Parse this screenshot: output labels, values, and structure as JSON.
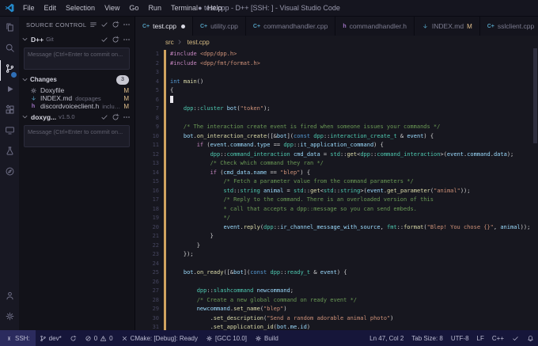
{
  "colors": {
    "accent_blue": "#2f6fb7",
    "git_modified": "#e2c08d",
    "modified_gutter": "#cfa35f",
    "status_bar_bg": "#16163a",
    "remote_item_bg": "#2b2b5e"
  },
  "title_bar": {
    "menus": [
      "File",
      "Edit",
      "Selection",
      "View",
      "Go",
      "Run",
      "Terminal",
      "Help"
    ],
    "title": "● test.cpp - D++ [SSH: ] - Visual Studio Code"
  },
  "activity_bar": {
    "top": [
      {
        "name": "explorer",
        "icon": "files"
      },
      {
        "name": "search",
        "icon": "search"
      },
      {
        "name": "source-control",
        "icon": "branch",
        "active": true,
        "badge": true
      },
      {
        "name": "run-and-debug",
        "icon": "debug"
      },
      {
        "name": "extensions",
        "icon": "extensions"
      },
      {
        "name": "remote-explorer",
        "icon": "monitor"
      },
      {
        "name": "testing",
        "icon": "beaker"
      },
      {
        "name": "gitlens",
        "icon": "compass"
      }
    ],
    "bottom": [
      {
        "name": "accounts",
        "icon": "person"
      },
      {
        "name": "manage-settings",
        "icon": "gear"
      }
    ]
  },
  "sidebar": {
    "title": "SOURCE CONTROL",
    "header_icons": [
      "list",
      "check",
      "refresh",
      "more"
    ],
    "repo1": {
      "name": "D++",
      "type": "Git",
      "icons": [
        "check",
        "refresh",
        "more"
      ]
    },
    "commit_placeholder": "Message (Ctrl+Enter to commit on...",
    "changes_label": "Changes",
    "changes_badge": "3",
    "files": [
      {
        "name": "Doxyfile",
        "desc": "",
        "status": "M",
        "icon": "gen"
      },
      {
        "name": "INDEX.md",
        "desc": "docpages",
        "status": "M",
        "icon": "md"
      },
      {
        "name": "discordvoiceclient.h",
        "desc": "include/d...",
        "status": "M",
        "icon": "h"
      }
    ],
    "repo2": {
      "name": "doxyg...",
      "version": "v1.5.0",
      "icons": [
        "check",
        "refresh",
        "more"
      ]
    },
    "commit_placeholder2": "Message (Ctrl+Enter to commit on..."
  },
  "tabs": [
    {
      "label": "test.cpp",
      "icon": "cpp",
      "active": true,
      "modified": true
    },
    {
      "label": "utility.cpp",
      "icon": "cpp"
    },
    {
      "label": "commandhandler.cpp",
      "icon": "cpp"
    },
    {
      "label": "commandhandler.h",
      "icon": "h"
    },
    {
      "label": "INDEX.md",
      "icon": "md",
      "badge": "M"
    },
    {
      "label": "sslclient.cpp",
      "icon": "cpp"
    }
  ],
  "breadcrumb": {
    "folder": "src",
    "file": "test.cpp",
    "file_icon": "cpp"
  },
  "editor": {
    "lines": [
      {
        "n": 1,
        "t": [
          [
            "pp",
            "#include"
          ],
          [
            "pl",
            " "
          ],
          [
            "st",
            "<dpp/dpp.h>"
          ]
        ]
      },
      {
        "n": 2,
        "t": [
          [
            "pp",
            "#include"
          ],
          [
            "pl",
            " "
          ],
          [
            "st",
            "<dpp/fmt/format.h>"
          ]
        ]
      },
      {
        "n": 3,
        "t": []
      },
      {
        "n": 4,
        "t": [
          [
            "kw",
            "int"
          ],
          [
            "pl",
            " "
          ],
          [
            "fn",
            "main"
          ],
          [
            "pl",
            "()"
          ]
        ]
      },
      {
        "n": 5,
        "t": [
          [
            "pl",
            "{"
          ]
        ]
      },
      {
        "n": 6,
        "cursor": true,
        "t": []
      },
      {
        "n": 7,
        "t": [
          [
            "pl",
            "    "
          ],
          [
            "ty",
            "dpp"
          ],
          [
            "pl",
            "::"
          ],
          [
            "ty",
            "cluster"
          ],
          [
            "pl",
            " "
          ],
          [
            "va",
            "bot"
          ],
          [
            "pl",
            "("
          ],
          [
            "st",
            "\"token\""
          ],
          [
            "pl",
            ");"
          ]
        ]
      },
      {
        "n": 8,
        "t": []
      },
      {
        "n": 9,
        "t": [
          [
            "pl",
            "    "
          ],
          [
            "cm",
            "/* The interaction create event is fired when someone issues your commands */"
          ]
        ]
      },
      {
        "n": 10,
        "t": [
          [
            "pl",
            "    "
          ],
          [
            "va",
            "bot"
          ],
          [
            "pl",
            "."
          ],
          [
            "fn",
            "on_interaction_create"
          ],
          [
            "pl",
            "([&"
          ],
          [
            "va",
            "bot"
          ],
          [
            "pl",
            "]("
          ],
          [
            "kw",
            "const"
          ],
          [
            "pl",
            " "
          ],
          [
            "ty",
            "dpp"
          ],
          [
            "pl",
            "::"
          ],
          [
            "ty",
            "interaction_create_t"
          ],
          [
            "pl",
            " & "
          ],
          [
            "va",
            "event"
          ],
          [
            "pl",
            ") {"
          ]
        ]
      },
      {
        "n": 11,
        "t": [
          [
            "pl",
            "        "
          ],
          [
            "ctl",
            "if"
          ],
          [
            "pl",
            " ("
          ],
          [
            "va",
            "event"
          ],
          [
            "pl",
            "."
          ],
          [
            "va",
            "command"
          ],
          [
            "pl",
            "."
          ],
          [
            "va",
            "type"
          ],
          [
            "pl",
            " == "
          ],
          [
            "ty",
            "dpp"
          ],
          [
            "pl",
            "::"
          ],
          [
            "va",
            "it_application_command"
          ],
          [
            "pl",
            ") {"
          ]
        ]
      },
      {
        "n": 12,
        "t": [
          [
            "pl",
            "            "
          ],
          [
            "ty",
            "dpp"
          ],
          [
            "pl",
            "::"
          ],
          [
            "ty",
            "command_interaction"
          ],
          [
            "pl",
            " "
          ],
          [
            "va",
            "cmd_data"
          ],
          [
            "pl",
            " = "
          ],
          [
            "ty",
            "std"
          ],
          [
            "pl",
            "::"
          ],
          [
            "fn",
            "get"
          ],
          [
            "pl",
            "<"
          ],
          [
            "ty",
            "dpp"
          ],
          [
            "pl",
            "::"
          ],
          [
            "ty",
            "command_interaction"
          ],
          [
            "pl",
            ">("
          ],
          [
            "va",
            "event"
          ],
          [
            "pl",
            "."
          ],
          [
            "va",
            "command"
          ],
          [
            "pl",
            "."
          ],
          [
            "va",
            "data"
          ],
          [
            "pl",
            ");"
          ]
        ]
      },
      {
        "n": 13,
        "t": [
          [
            "pl",
            "            "
          ],
          [
            "cm",
            "/* Check which command they ran */"
          ]
        ]
      },
      {
        "n": 14,
        "t": [
          [
            "pl",
            "            "
          ],
          [
            "ctl",
            "if"
          ],
          [
            "pl",
            " ("
          ],
          [
            "va",
            "cmd_data"
          ],
          [
            "pl",
            "."
          ],
          [
            "va",
            "name"
          ],
          [
            "pl",
            " == "
          ],
          [
            "st",
            "\"blep\""
          ],
          [
            "pl",
            ") {"
          ]
        ]
      },
      {
        "n": 15,
        "t": [
          [
            "pl",
            "                "
          ],
          [
            "cm",
            "/* Fetch a parameter value from the command parameters */"
          ]
        ]
      },
      {
        "n": 16,
        "t": [
          [
            "pl",
            "                "
          ],
          [
            "ty",
            "std"
          ],
          [
            "pl",
            "::"
          ],
          [
            "ty",
            "string"
          ],
          [
            "pl",
            " "
          ],
          [
            "va",
            "animal"
          ],
          [
            "pl",
            " = "
          ],
          [
            "ty",
            "std"
          ],
          [
            "pl",
            "::"
          ],
          [
            "fn",
            "get"
          ],
          [
            "pl",
            "<"
          ],
          [
            "ty",
            "std"
          ],
          [
            "pl",
            "::"
          ],
          [
            "ty",
            "string"
          ],
          [
            "pl",
            ">("
          ],
          [
            "va",
            "event"
          ],
          [
            "pl",
            "."
          ],
          [
            "fn",
            "get_parameter"
          ],
          [
            "pl",
            "("
          ],
          [
            "st",
            "\"animal\""
          ],
          [
            "pl",
            "));"
          ]
        ]
      },
      {
        "n": 17,
        "t": [
          [
            "pl",
            "                "
          ],
          [
            "cm",
            "/* Reply to the command. There is an overloaded version of this"
          ]
        ]
      },
      {
        "n": 18,
        "t": [
          [
            "pl",
            "                "
          ],
          [
            "cm",
            "* call that accepts a dpp::message so you can send embeds."
          ]
        ]
      },
      {
        "n": 19,
        "t": [
          [
            "pl",
            "                "
          ],
          [
            "cm",
            "*/"
          ]
        ]
      },
      {
        "n": 20,
        "t": [
          [
            "pl",
            "                "
          ],
          [
            "va",
            "event"
          ],
          [
            "pl",
            "."
          ],
          [
            "fn",
            "reply"
          ],
          [
            "pl",
            "("
          ],
          [
            "ty",
            "dpp"
          ],
          [
            "pl",
            "::"
          ],
          [
            "va",
            "ir_channel_message_with_source"
          ],
          [
            "pl",
            ", "
          ],
          [
            "ty",
            "fmt"
          ],
          [
            "pl",
            "::"
          ],
          [
            "fn",
            "format"
          ],
          [
            "pl",
            "("
          ],
          [
            "st",
            "\"Blep! You chose {}\""
          ],
          [
            "pl",
            ", "
          ],
          [
            "va",
            "animal"
          ],
          [
            "pl",
            "));"
          ]
        ]
      },
      {
        "n": 21,
        "t": [
          [
            "pl",
            "            }"
          ]
        ]
      },
      {
        "n": 22,
        "t": [
          [
            "pl",
            "        }"
          ]
        ]
      },
      {
        "n": 23,
        "t": [
          [
            "pl",
            "    });"
          ]
        ]
      },
      {
        "n": 24,
        "t": []
      },
      {
        "n": 25,
        "t": [
          [
            "pl",
            "    "
          ],
          [
            "va",
            "bot"
          ],
          [
            "pl",
            "."
          ],
          [
            "fn",
            "on_ready"
          ],
          [
            "pl",
            "([&"
          ],
          [
            "va",
            "bot"
          ],
          [
            "pl",
            "]("
          ],
          [
            "kw",
            "const"
          ],
          [
            "pl",
            " "
          ],
          [
            "ty",
            "dpp"
          ],
          [
            "pl",
            "::"
          ],
          [
            "ty",
            "ready_t"
          ],
          [
            "pl",
            " & "
          ],
          [
            "va",
            "event"
          ],
          [
            "pl",
            ") {"
          ]
        ]
      },
      {
        "n": 26,
        "t": []
      },
      {
        "n": 27,
        "t": [
          [
            "pl",
            "        "
          ],
          [
            "ty",
            "dpp"
          ],
          [
            "pl",
            "::"
          ],
          [
            "ty",
            "slashcommand"
          ],
          [
            "pl",
            " "
          ],
          [
            "va",
            "newcommand"
          ],
          [
            "pl",
            ";"
          ]
        ]
      },
      {
        "n": 28,
        "t": [
          [
            "pl",
            "        "
          ],
          [
            "cm",
            "/* Create a new global command on ready event */"
          ]
        ]
      },
      {
        "n": 29,
        "t": [
          [
            "pl",
            "        "
          ],
          [
            "va",
            "newcommand"
          ],
          [
            "pl",
            "."
          ],
          [
            "fn",
            "set_name"
          ],
          [
            "pl",
            "("
          ],
          [
            "st",
            "\"blep\""
          ],
          [
            "pl",
            ")"
          ]
        ]
      },
      {
        "n": 30,
        "t": [
          [
            "pl",
            "            ."
          ],
          [
            "fn",
            "set_description"
          ],
          [
            "pl",
            "("
          ],
          [
            "st",
            "\"Send a random adorable animal photo\""
          ],
          [
            "pl",
            ")"
          ]
        ]
      },
      {
        "n": 31,
        "t": [
          [
            "pl",
            "            ."
          ],
          [
            "fn",
            "set_application_id"
          ],
          [
            "pl",
            "("
          ],
          [
            "va",
            "bot"
          ],
          [
            "pl",
            "."
          ],
          [
            "va",
            "me"
          ],
          [
            "pl",
            "."
          ],
          [
            "va",
            "id"
          ],
          [
            "pl",
            ")"
          ]
        ]
      }
    ]
  },
  "status_bar": {
    "left": [
      {
        "name": "remote-indicator",
        "icon": "remote",
        "label": "SSH:"
      },
      {
        "name": "git-branch",
        "icon": "branch",
        "label": "dev*"
      },
      {
        "name": "sync-changes",
        "icon": "sync",
        "label": ""
      },
      {
        "name": "problems",
        "icon": "error",
        "label": "0",
        "icon2": "warning",
        "label2": "0"
      },
      {
        "name": "cmake-status",
        "icon": "close",
        "label": "CMake: [Debug]: Ready"
      },
      {
        "name": "cmake-kit",
        "icon": "gear",
        "label": "[GCC 10.0]"
      },
      {
        "name": "cmake-build",
        "icon": "gear",
        "label": "Build"
      }
    ],
    "right": [
      {
        "name": "cursor-position",
        "label": "Ln 47, Col 2"
      },
      {
        "name": "tab-size",
        "label": "Tab Size: 8"
      },
      {
        "name": "encoding",
        "label": "UTF-8"
      },
      {
        "name": "eol",
        "label": "LF"
      },
      {
        "name": "language-mode",
        "label": "C++"
      },
      {
        "name": "format-status",
        "icon": "check",
        "label": ""
      },
      {
        "name": "notifications",
        "icon": "bell",
        "label": ""
      }
    ]
  }
}
